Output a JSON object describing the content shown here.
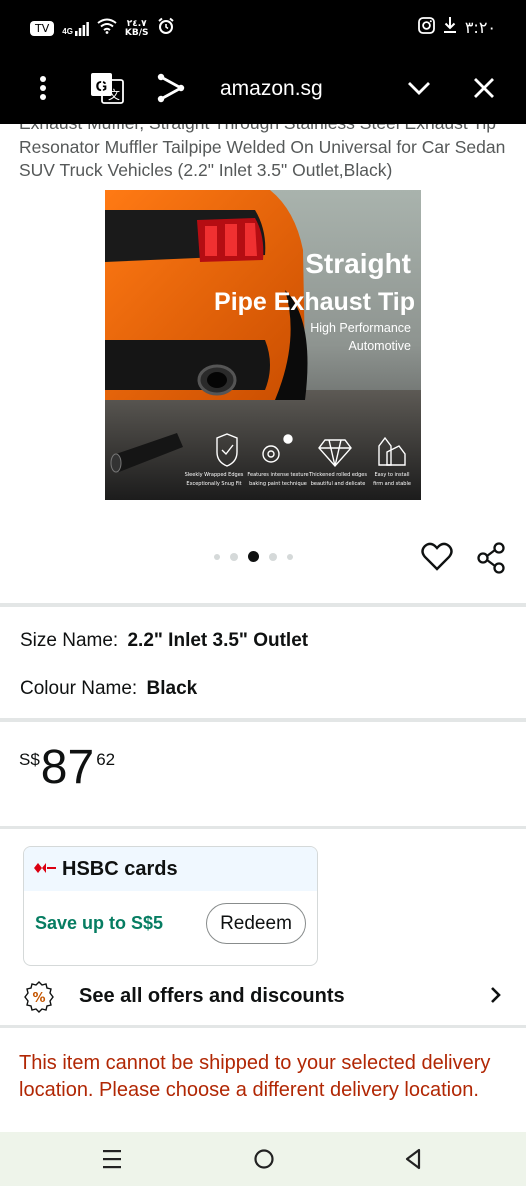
{
  "status_bar": {
    "badge": "TV",
    "network_type": "4G",
    "speed_value": "٢٤.٧",
    "speed_unit": "KB/S",
    "time": "٣:٢٠"
  },
  "browser": {
    "url": "amazon.sg"
  },
  "product": {
    "title": "Exhaust Muffler, Straight Through Stainless Steel Exhaust Tip Resonator Muffler Tailpipe Welded On Universal for Car Sedan SUV Truck Vehicles (2.2\" Inlet 3.5\" Outlet,Black)",
    "image": {
      "headline_1": "Straight",
      "headline_2": "Pipe Exhaust Tip",
      "sub_1": "High Performance",
      "sub_2": "Automotive",
      "features": [
        {
          "line1": "Sleekly Wrapped Edges",
          "line2": "Exceptionally Snug Fit"
        },
        {
          "line1": "Features intense texture",
          "line2": "baking paint technique"
        },
        {
          "line1": "Thickened rolled edges",
          "line2": "beautiful and delicate"
        },
        {
          "line1": "Easy to install",
          "line2": "firm and stable"
        }
      ]
    },
    "carousel": {
      "count": 5,
      "active": 3
    }
  },
  "variants": {
    "size_label": "Size Name:",
    "size_value": "2.2\" Inlet 3.5\" Outlet",
    "colour_label": "Colour Name:",
    "colour_value": "Black"
  },
  "price": {
    "currency": "S$",
    "whole": "87",
    "fraction": "62"
  },
  "offer": {
    "bank": "HSBC cards",
    "save_text": "Save up to S$5",
    "redeem_label": "Redeem"
  },
  "offers_link": {
    "label": "See all offers and discounts"
  },
  "shipping": {
    "warning": "This item cannot be shipped to your selected delivery location. Please choose a different delivery location."
  },
  "colors": {
    "price_save": "#067d62",
    "warning": "#b12704",
    "hsbc_red": "#db0011"
  }
}
